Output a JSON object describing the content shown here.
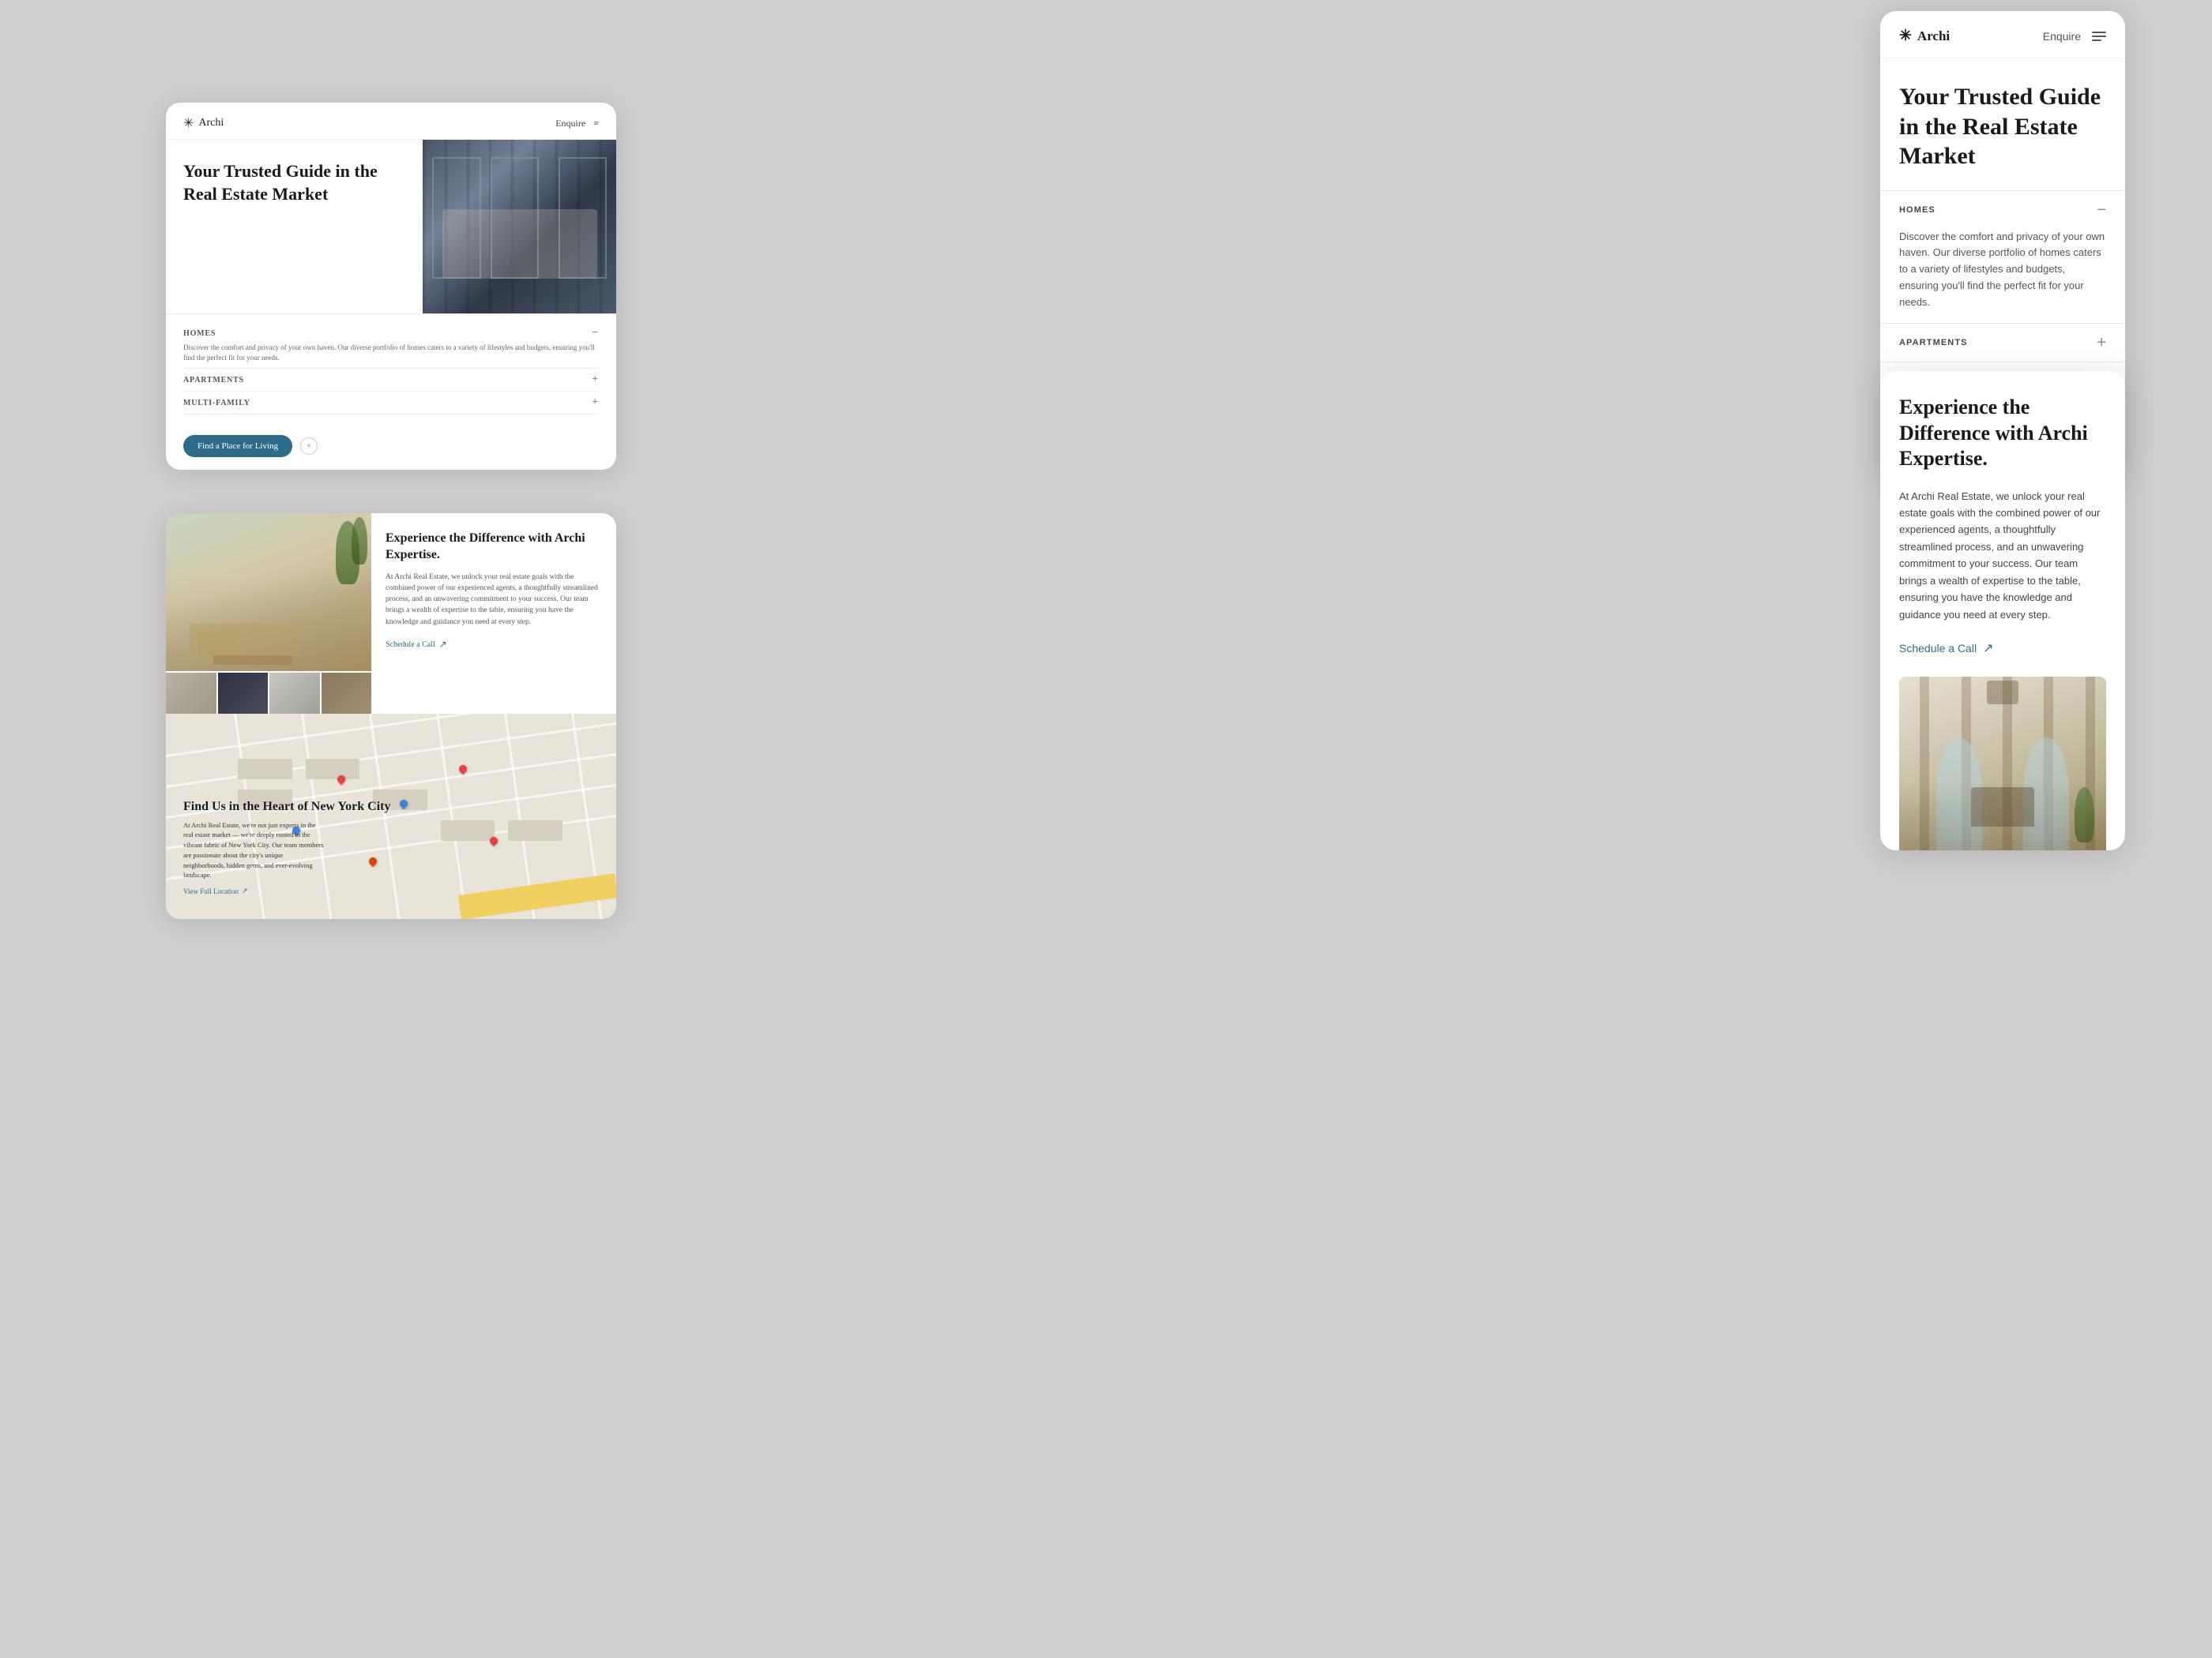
{
  "brand": {
    "name": "Archi",
    "star_icon": "✳"
  },
  "left_card": {
    "nav_enquire": "Enquire",
    "nav_menu_icon": "≡",
    "hero_title": "Your Trusted Guide in the Real Estate Market",
    "accordion": {
      "homes": {
        "label": "HOMES",
        "body": "Discover the comfort and privacy of your own haven. Our diverse portfolio of homes caters to a variety of lifestyles and budgets, ensuring you'll find the perfect fit for your needs.",
        "icon_open": "−"
      },
      "apartments": {
        "label": "APARTMENTS",
        "icon_close": "+"
      },
      "multi_family": {
        "label": "MULTI-FAMILY",
        "icon_close": "+"
      }
    },
    "cta_btn": "Find a Place for Living",
    "cta_close": "×"
  },
  "expertise_section": {
    "title": "Experience the Difference with Archi Expertise.",
    "body": "At Archi Real Estate, we unlock your real estate goals with the combined power of our experienced agents, a thoughtfully streamlined process, and an unwavering commitment to your success. Our team brings a wealth of expertise to the table, ensuring you have the knowledge and guidance you need at every step.",
    "schedule_link": "Schedule a Call",
    "arrow": "↗"
  },
  "map_section": {
    "title": "Find Us in the Heart of New York City",
    "body": "At Archi Real Estate, we're not just experts in the real estate market — we're deeply rooted in the vibrant fabric of New York City. Our team members are passionate about the city's unique neighborhoods, hidden gems, and ever-evolving landscape.",
    "view_location": "View Full Location",
    "arrow": "↗"
  },
  "right_panel_1": {
    "nav_enquire": "Enquire",
    "hero_title": "Your Trusted Guide in the Real Estate Market",
    "accordion": {
      "homes": {
        "label": "HOMES",
        "body": "Discover the comfort and privacy of your own haven. Our diverse portfolio of homes caters to a variety of lifestyles and budgets, ensuring you'll find the perfect fit for your needs.",
        "icon": "−"
      },
      "apartments": {
        "label": "APARTMENTS",
        "icon": "+"
      },
      "multi_family": {
        "label": "MULTI-FAMILY",
        "icon": "+"
      }
    },
    "cta_btn": "Find a Place for Living"
  },
  "right_panel_2": {
    "title": "Experience the Difference with Archi Expertise.",
    "body": "At Archi Real Estate, we unlock your real estate goals with the combined power of our experienced agents, a thoughtfully streamlined process, and an unwavering commitment to your success. Our team brings a wealth of expertise to the table, ensuring you have the knowledge and guidance you need at every step.",
    "schedule_link": "Schedule a Call",
    "arrow": "↗"
  },
  "colors": {
    "teal": "#2d6b8a",
    "dark": "#1a1a1a",
    "gray_bg": "#d0cece",
    "white": "#ffffff"
  }
}
